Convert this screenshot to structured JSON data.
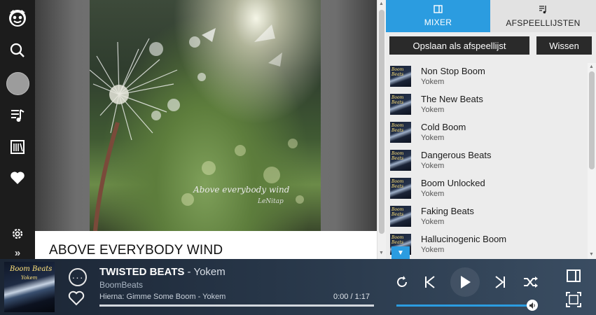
{
  "album": {
    "title": "ABOVE EVERYBODY WIND",
    "art_caption": "Above everybody wind",
    "art_signature": "LeNitap"
  },
  "sidebar": {
    "icons": [
      "napster-logo-icon",
      "search-icon",
      "avatar",
      "music-note-icon",
      "library-icon",
      "heart-icon",
      "gear-icon",
      "chevron-double-right-icon"
    ],
    "expand_label": "»"
  },
  "panel": {
    "tabs": [
      {
        "label": "MIXER",
        "active": true,
        "icon": "mixer-icon"
      },
      {
        "label": "AFSPEELLIJSTEN",
        "active": false,
        "icon": "playlist-icon"
      }
    ],
    "save_label": "Opslaan als afspeellijst",
    "clear_label": "Wissen",
    "queue": [
      {
        "title": "Non Stop Boom",
        "artist": "Yokem"
      },
      {
        "title": "The New Beats",
        "artist": "Yokem"
      },
      {
        "title": "Cold Boom",
        "artist": "Yokem"
      },
      {
        "title": "Dangerous Beats",
        "artist": "Yokem"
      },
      {
        "title": "Boom Unlocked",
        "artist": "Yokem"
      },
      {
        "title": "Faking Beats",
        "artist": "Yokem"
      },
      {
        "title": "Hallucinogenic Boom",
        "artist": "Yokem"
      }
    ]
  },
  "player": {
    "cover_title": "Boom Beats",
    "cover_artist": "Yokem",
    "track": "TWISTED BEATS",
    "separator": " - ",
    "artist": "Yokem",
    "album": "BoomBeats",
    "next_up": "Hierna: Gimme Some Boom - Yokem",
    "time": "0:00 / 1:17",
    "progress_fraction": 0,
    "volume_fraction": 1,
    "accent_color": "#2b9ce0"
  }
}
